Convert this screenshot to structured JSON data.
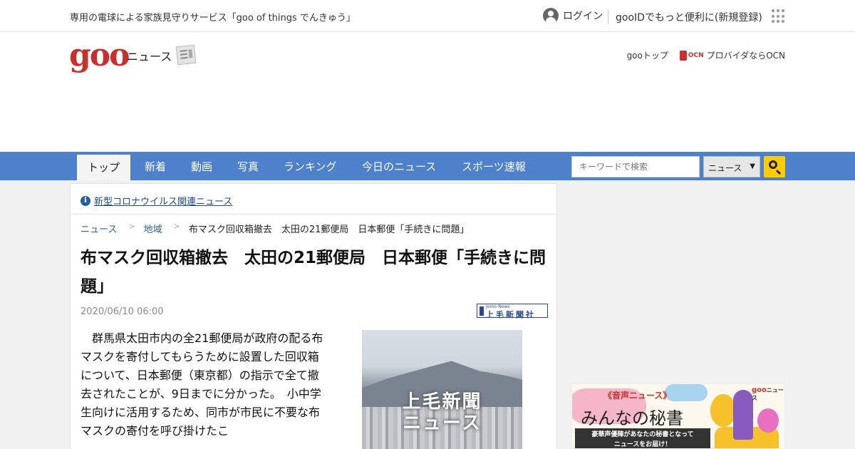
{
  "topbar": {
    "promo": "専用の電球による家族見守りサービス「goo of things でんきゅう」",
    "login": "ログイン",
    "register": "gooIDでもっと便利に(新規登録)"
  },
  "header": {
    "logo": "goo",
    "section": "ニュース",
    "goo_top": "gooトップ",
    "ocn_mark": "OCN",
    "ocn_text": "プロバイダならOCN"
  },
  "nav": {
    "tabs": [
      {
        "label": "トップ",
        "active": true
      },
      {
        "label": "新着"
      },
      {
        "label": "動画"
      },
      {
        "label": "写真"
      },
      {
        "label": "ランキング"
      },
      {
        "label": "今日のニュース"
      },
      {
        "label": "スポーツ速報"
      }
    ],
    "search_placeholder": "キーワードで検索",
    "search_scope": "ニュース",
    "search_scope_caret": "▼"
  },
  "article": {
    "covid_link": "新型コロナウイルス関連ニュース",
    "breadcrumb": [
      "ニュース",
      "地域",
      "布マスク回収箱撤去　太田の21郵便局　日本郵便「手続きに問題」"
    ],
    "breadcrumb_sep": ">",
    "title": "布マスク回収箱撤去　太田の21郵便局　日本郵便「手続きに問題」",
    "date": "2020/06/10 06:00",
    "source_small": "Jomo-News",
    "source_name": "上毛新聞社",
    "body": "群馬県太田市内の全21郵便局が政府の配る布マスクを寄付してもらうために設置した回収箱について、日本郵便（東京都）の指示で全て撤去されたことが、9日までに分かった。　小中学生向けに活用するため、同市が市民に不要な布マスクの寄付を呼び掛けたこ",
    "thumb_caption_1": "上毛新聞",
    "thumb_caption_2": "ニュース"
  },
  "ad": {
    "tag": "《音声ニュース》",
    "headline": "みんなの秘書",
    "sub_1": "豪華声優陣があなたの秘書となって",
    "sub_2": "ニュースをお届け！",
    "brand": "goo",
    "brand_suffix": "ニュース"
  },
  "colors": {
    "nav_blue": "#4d81cc",
    "goo_red": "#c8312b",
    "search_yellow": "#ffcc00",
    "link_blue": "#2a5ea6"
  }
}
